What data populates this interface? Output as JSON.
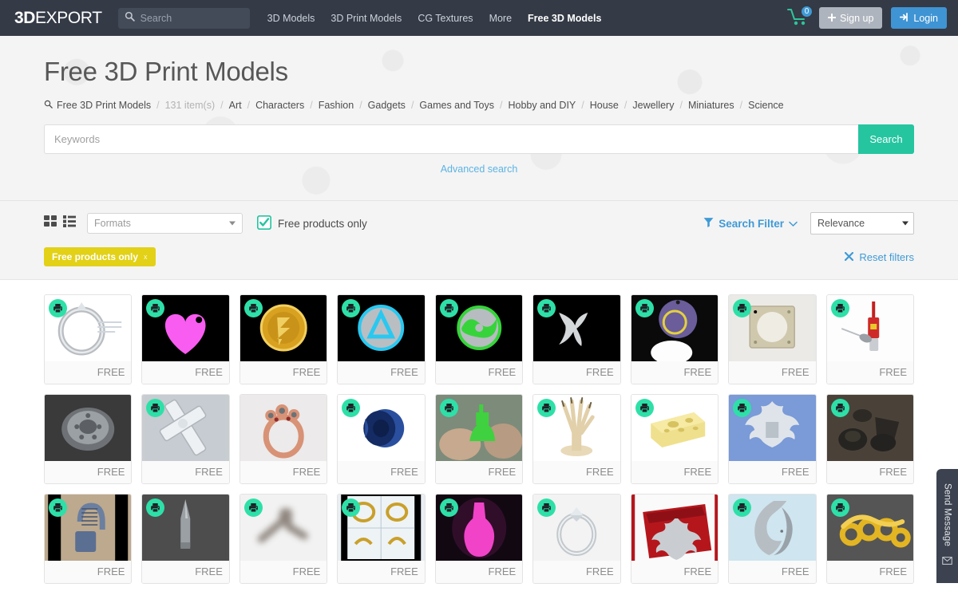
{
  "header": {
    "logo_bold": "3D",
    "logo_rest": "EXPORT",
    "search_placeholder": "Search",
    "search_icon": "search-icon",
    "nav": [
      {
        "label": "3D Models",
        "active": false
      },
      {
        "label": "3D Print Models",
        "active": false
      },
      {
        "label": "CG Textures",
        "active": false
      },
      {
        "label": "More",
        "active": false
      },
      {
        "label": "Free 3D Models",
        "active": true
      }
    ],
    "cart_icon": "shopping-cart-icon",
    "cart_count": "0",
    "signup_label": "Sign up",
    "signup_icon": "plus-icon",
    "login_label": "Login",
    "login_icon": "login-arrow-icon",
    "colors": {
      "navbar": "#343a46",
      "login": "#3f94d4",
      "signup": "#aeb4bd",
      "cart_badge": "#3f9ad6",
      "cart": "#2ec49a"
    }
  },
  "hero": {
    "title": "Free 3D Print Models",
    "breadcrumb_icon": "search-icon",
    "breadcrumb": [
      {
        "label": "Free 3D Print Models",
        "muted": false
      },
      {
        "label": "131 item(s)",
        "muted": true
      },
      {
        "label": "Art",
        "muted": false
      },
      {
        "label": "Characters",
        "muted": false
      },
      {
        "label": "Fashion",
        "muted": false
      },
      {
        "label": "Gadgets",
        "muted": false
      },
      {
        "label": "Games and Toys",
        "muted": false
      },
      {
        "label": "Hobby and DIY",
        "muted": false
      },
      {
        "label": "House",
        "muted": false
      },
      {
        "label": "Jewellery",
        "muted": false
      },
      {
        "label": "Miniatures",
        "muted": false
      },
      {
        "label": "Science",
        "muted": false
      }
    ],
    "keywords_value": "",
    "keywords_placeholder": "Keywords",
    "search_button": "Search",
    "advanced_search": "Advanced search",
    "search_button_color": "#25c5a0"
  },
  "filters": {
    "grid_view_icon": "grid-view-icon",
    "list_view_icon": "list-view-icon",
    "formats_label": "Formats",
    "formats_caret_icon": "chevron-down-icon",
    "free_only_label": "Free products only",
    "free_only_checked": true,
    "free_only_check_icon": "checkbox-checked-icon",
    "search_filter_label": "Search Filter",
    "search_filter_icon": "funnel-icon",
    "search_filter_caret_icon": "chevron-down-icon",
    "sort_value": "Relevance",
    "sort_options": [
      "Relevance"
    ],
    "active_chip": "Free products only",
    "active_chip_close": "x",
    "active_chip_color": "#e2d116",
    "reset_label": "Reset filters",
    "reset_icon": "close-x-icon",
    "link_color": "#3f9ad6"
  },
  "products": {
    "badge_icon": "3d-printer-icon",
    "price_label": "FREE",
    "items": [
      {
        "name": "diamond-ring-set",
        "badge": true,
        "bg": "#ffffff",
        "art": "ring-silver"
      },
      {
        "name": "pink-heart-tag",
        "badge": true,
        "bg": "#000000",
        "art": "heart-pink"
      },
      {
        "name": "gold-coin-medal",
        "badge": true,
        "bg": "#000000",
        "art": "coin-gold"
      },
      {
        "name": "blue-triangle-emblem",
        "badge": true,
        "bg": "#000000",
        "art": "emblem-cyan"
      },
      {
        "name": "green-swirl-emblem",
        "badge": true,
        "bg": "#000000",
        "art": "emblem-green"
      },
      {
        "name": "white-symbol-glyph",
        "badge": true,
        "bg": "#000000",
        "art": "glyph-white"
      },
      {
        "name": "purple-disc-lamp",
        "badge": true,
        "bg": "#0a0a0a",
        "art": "disc-purple"
      },
      {
        "name": "white-fan-shroud",
        "badge": true,
        "bg": "#e9e9e7",
        "art": "shroud-white"
      },
      {
        "name": "red-tool-probe",
        "badge": true,
        "bg": "#fdfdfd",
        "art": "probe-red"
      },
      {
        "name": "grey-wheel-rim",
        "badge": false,
        "bg": "#3a3a3a",
        "art": "wheel-grey"
      },
      {
        "name": "ornate-cross",
        "badge": true,
        "bg": "#c8cdd2",
        "art": "cross-silver"
      },
      {
        "name": "rose-gold-gem-ring",
        "badge": false,
        "bg": "#eceaea",
        "art": "ring-rose"
      },
      {
        "name": "blue-impeller",
        "badge": true,
        "bg": "#ffffff",
        "art": "impeller-blue"
      },
      {
        "name": "green-benchy-boat",
        "badge": true,
        "bg": "#7d8b7a",
        "art": "boat-green"
      },
      {
        "name": "pencil-holder-hand",
        "badge": true,
        "bg": "#ffffff",
        "art": "hand-tan"
      },
      {
        "name": "cheese-block",
        "badge": true,
        "bg": "#ffffff",
        "art": "cheese-yellow"
      },
      {
        "name": "double-eagle-crest",
        "badge": true,
        "bg": "#7a9ad8",
        "art": "eagle-silver"
      },
      {
        "name": "dark-machine-parts",
        "badge": true,
        "bg": "#4a4238",
        "art": "parts-dark"
      },
      {
        "name": "blue-padlock-print",
        "badge": true,
        "bg": "#bda98e",
        "art": "padlock-blue"
      },
      {
        "name": "grey-bullet-round",
        "badge": true,
        "bg": "#4d4d4d",
        "art": "bullet-grey"
      },
      {
        "name": "blurred-bracket-part",
        "badge": true,
        "bg": "#f2f2f2",
        "art": "bracket-blur"
      },
      {
        "name": "jewellery-cad-sheet",
        "badge": true,
        "bg": "#e8eef2",
        "art": "cad-sheet"
      },
      {
        "name": "pink-vase-glow",
        "badge": true,
        "bg": "#120812",
        "art": "vase-pink"
      },
      {
        "name": "solitaire-pave-ring",
        "badge": true,
        "bg": "#f3f3f3",
        "art": "ring-solitaire"
      },
      {
        "name": "eagle-crest-box",
        "badge": false,
        "bg": "#b5161c",
        "art": "crest-red"
      },
      {
        "name": "grey-curved-ring",
        "badge": true,
        "bg": "#cfe5ef",
        "art": "ring-curved"
      },
      {
        "name": "gold-knuckle-piece",
        "badge": true,
        "bg": "#555555",
        "art": "knuckle-gold"
      }
    ]
  },
  "widget": {
    "send_message_label": "Send Message",
    "envelope_icon": "envelope-icon"
  }
}
